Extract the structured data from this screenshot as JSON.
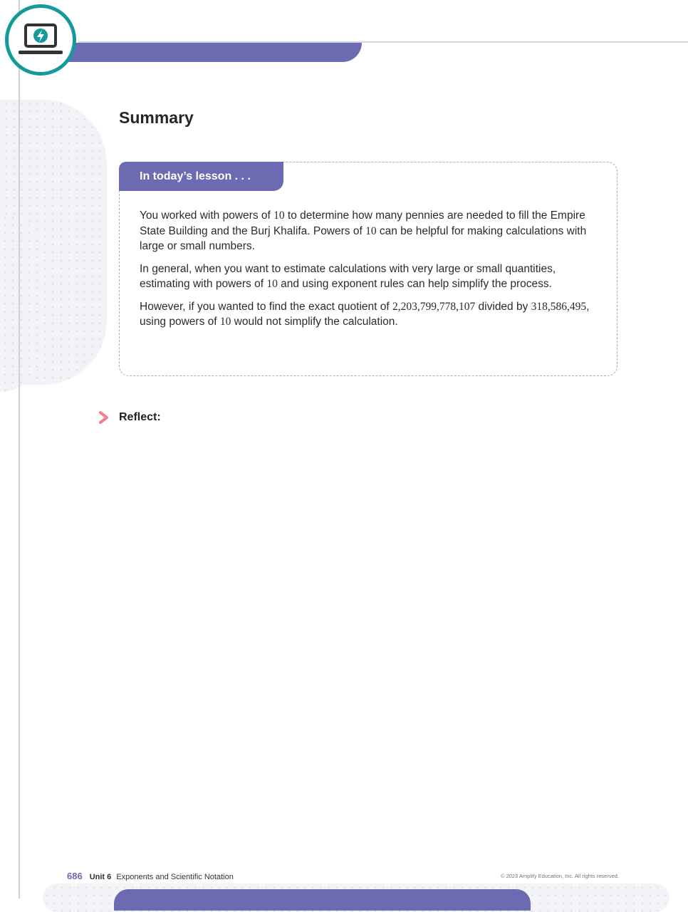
{
  "summary": {
    "title": "Summary"
  },
  "lesson": {
    "tab_label": "In today’s lesson . . .",
    "p1": [
      "You worked with powers of ",
      "10",
      " to determine how many pennies are needed to fill the Empire State Building and the Burj Khalifa. Powers of ",
      "10",
      " can be helpful for making calculations with large or small numbers."
    ],
    "p2": [
      "In general, when you want to estimate calculations with very large or small quantities, estimating with powers of ",
      "10",
      " and using exponent rules can help simplify the process."
    ],
    "p3": [
      "However, if you wanted to find the exact quotient of ",
      "2,203,799,778,107",
      " divided by ",
      "318,586,495",
      ", using powers of ",
      "10",
      " would not simplify the calculation."
    ]
  },
  "reflect": {
    "label": "Reflect:"
  },
  "footer": {
    "page_number": "686",
    "unit": "Unit 6",
    "unit_title": "Exponents and Scientific Notation",
    "copyright": "© 2023 Amplify Education, Inc. All rights reserved."
  },
  "colors": {
    "accent": "#6c6ab0",
    "badge": "#149a9b",
    "reflect_chevron": "#f0808a"
  },
  "icons": {
    "badge": "laptop-lightning-icon",
    "reflect": "chevron-right-icon"
  }
}
